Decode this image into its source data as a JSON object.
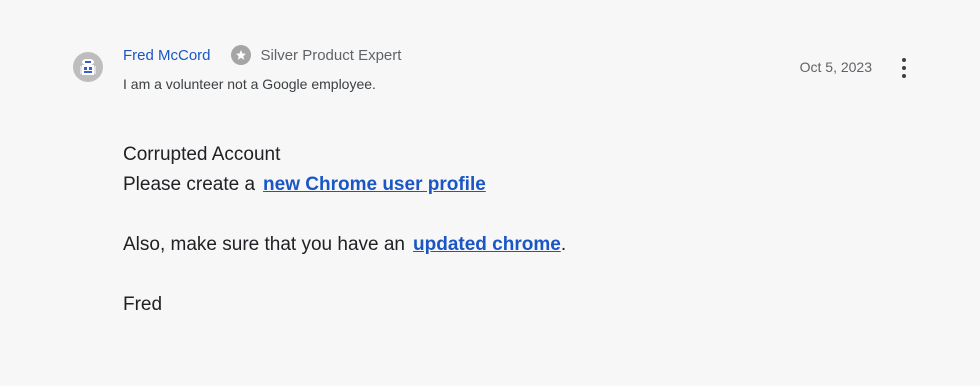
{
  "author": {
    "name": "Fred McCord",
    "badge": "Silver Product Expert",
    "note": "I am a volunteer not a Google employee.",
    "avatar_icon": "robot-avatar-icon",
    "badge_icon": "star-icon"
  },
  "post": {
    "date": "Oct 5, 2023",
    "menu_icon": "more-vert-icon",
    "line1": "Corrupted Account",
    "line2_prefix": "Please create a",
    "link1": "new Chrome user profile",
    "line3_prefix": "Also, make sure that you have an",
    "link2": "updated chrome",
    "line3_suffix": ".",
    "signature": "Fred"
  },
  "colors": {
    "link": "#1a56c4",
    "background": "#f7f7f7",
    "badge": "#a5a5a5"
  }
}
